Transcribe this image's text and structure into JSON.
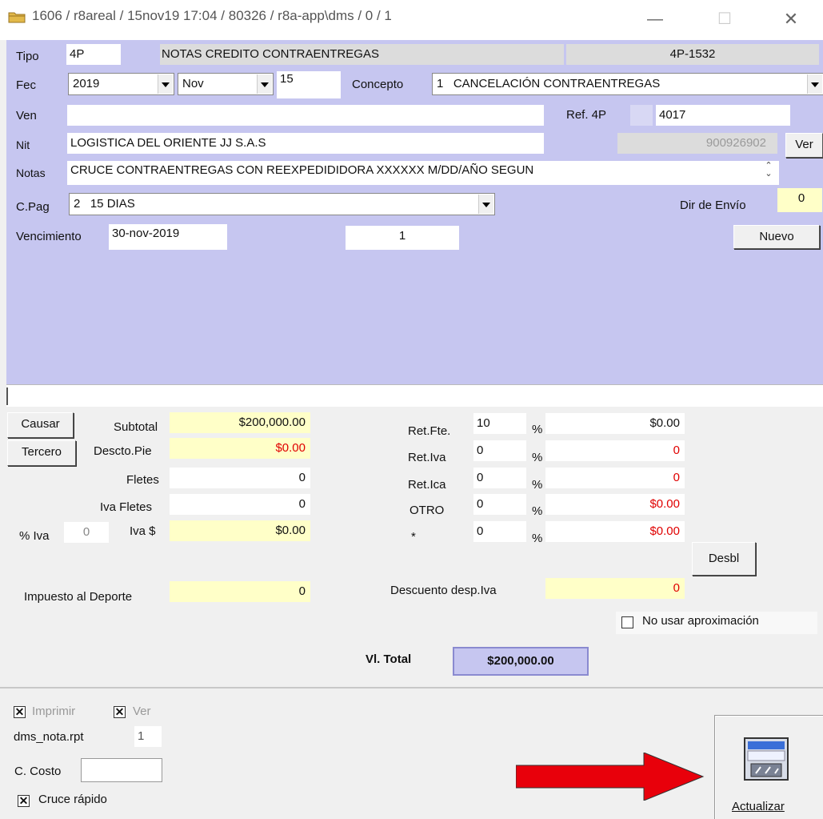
{
  "window": {
    "title": "1606 / r8areal / 15nov19 17:04 / 80326 / r8a-app\\dms / 0 / 1",
    "minimize": "—",
    "maximize": "☐",
    "close": "✕"
  },
  "header": {
    "tipo_label": "Tipo",
    "tipo_value": "4P",
    "tipo_desc": "NOTAS CREDITO CONTRAENTREGAS",
    "doc_number": "4P-1532",
    "fec_label": "Fec",
    "year": "2019",
    "month": "Nov",
    "day": "15",
    "concepto_label": "Concepto",
    "concepto_value": "1   CANCELACIÓN CONTRAENTREGAS",
    "ven_label": "Ven",
    "ven_value": "",
    "ref_label": "Ref. 4P",
    "ref_value": "4017",
    "nit_label": "Nit",
    "nit_name": "LOGISTICA DEL ORIENTE JJ S.A.S",
    "nit_number": "900926902",
    "ver_button": "Ver",
    "notas_label": "Notas",
    "notas_value": "CRUCE CONTRAENTREGAS CON REEXPEDIDIDORA XXXXXX M/DD/AÑO SEGUN",
    "cpag_label": "C.Pag",
    "cpag_value": "2   15 DIAS",
    "dir_envio_label": "Dir de Envío",
    "dir_envio_value": "0",
    "vencimiento_label": "Vencimiento",
    "vencimiento_value": "30-nov-2019",
    "cuotas_value": "1",
    "nuevo_button": "Nuevo"
  },
  "totals": {
    "causar_button": "Causar",
    "tercero_button": "Tercero",
    "subtotal_label": "Subtotal",
    "subtotal_value": "$200,000.00",
    "descto_label": "Descto.Pie",
    "descto_value": "$0.00",
    "fletes_label": "Fletes",
    "fletes_value": "0",
    "iva_fletes_label": "Iva Fletes",
    "iva_fletes_value": "0",
    "pct_iva_label": "% Iva",
    "pct_iva_value": "0",
    "iva_label": "Iva $",
    "iva_value": "$0.00",
    "impuesto_label": "Impuesto al Deporte",
    "impuesto_value": "0",
    "ret_fte_label": "Ret.Fte.",
    "ret_fte_pct": "10",
    "ret_fte_value": "$0.00",
    "ret_iva_label": "Ret.Iva",
    "ret_iva_pct": "0",
    "ret_iva_value": "0",
    "ret_ica_label": "Ret.Ica",
    "ret_ica_pct": "0",
    "ret_ica_value": "0",
    "otro_label": "OTRO",
    "otro_pct": "0",
    "otro_value": "$0.00",
    "star_label": "*",
    "star_pct": "0",
    "star_value": "$0.00",
    "pct_symbol": "%",
    "desbl_button": "Desbl",
    "descuento_label": "Descuento desp.Iva",
    "descuento_value": "0",
    "no_aprox_label": "No usar aproximación",
    "vl_total_label": "Vl. Total",
    "vl_total_value": "$200,000.00"
  },
  "footer": {
    "imprimir_label": "Imprimir",
    "ver_label": "Ver",
    "report_name": "dms_nota.rpt",
    "copies": "1",
    "ccosto_label": "C. Costo",
    "ccosto_value": "",
    "cruce_label": "Cruce rápido",
    "check_mark": "✕",
    "actualizar_button": "Actualizar"
  },
  "colors": {
    "panel_blue": "#c6c6f0",
    "field_yellow": "#ffffc8",
    "negative_red": "#e00000",
    "arrow_red": "#e8000b"
  }
}
